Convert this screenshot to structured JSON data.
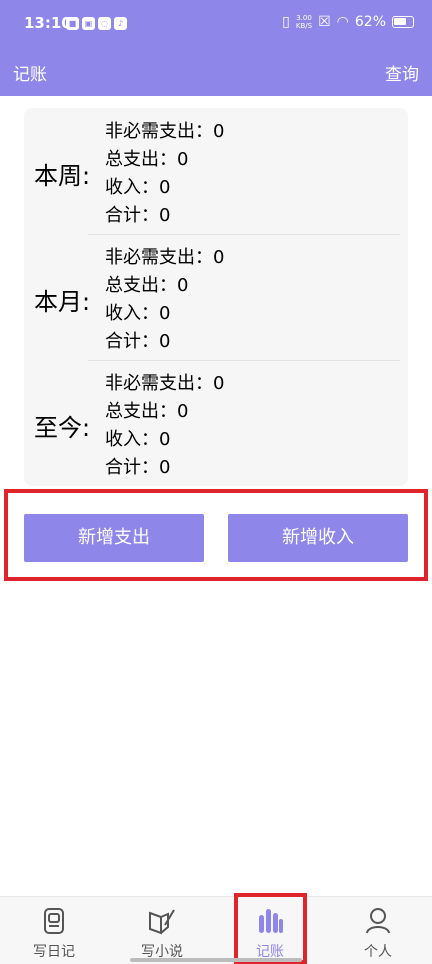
{
  "status": {
    "time": "13:10",
    "net_speed_value": "3.00",
    "net_speed_unit": "KB/S",
    "battery": "62%"
  },
  "appbar": {
    "title": "记账",
    "query": "查询"
  },
  "sections": [
    {
      "period": "本周:",
      "lines": [
        "非必需支出：0",
        "总支出：0",
        "收入：0",
        "合计：0"
      ]
    },
    {
      "period": "本月:",
      "lines": [
        "非必需支出：0",
        "总支出：0",
        "收入：0",
        "合计：0"
      ]
    },
    {
      "period": "至今:",
      "lines": [
        "非必需支出：0",
        "总支出：0",
        "收入：0",
        "合计：0"
      ]
    }
  ],
  "buttons": {
    "add_expense": "新增支出",
    "add_income": "新增收入"
  },
  "nav": [
    {
      "label": "写日记",
      "icon": "diary-icon",
      "active": false
    },
    {
      "label": "写小说",
      "icon": "novel-icon",
      "active": false
    },
    {
      "label": "记账",
      "icon": "accounting-icon",
      "active": true
    },
    {
      "label": "个人",
      "icon": "person-icon",
      "active": false
    }
  ],
  "colors": {
    "primary": "#8f86ea",
    "highlight": "#e0242b"
  }
}
